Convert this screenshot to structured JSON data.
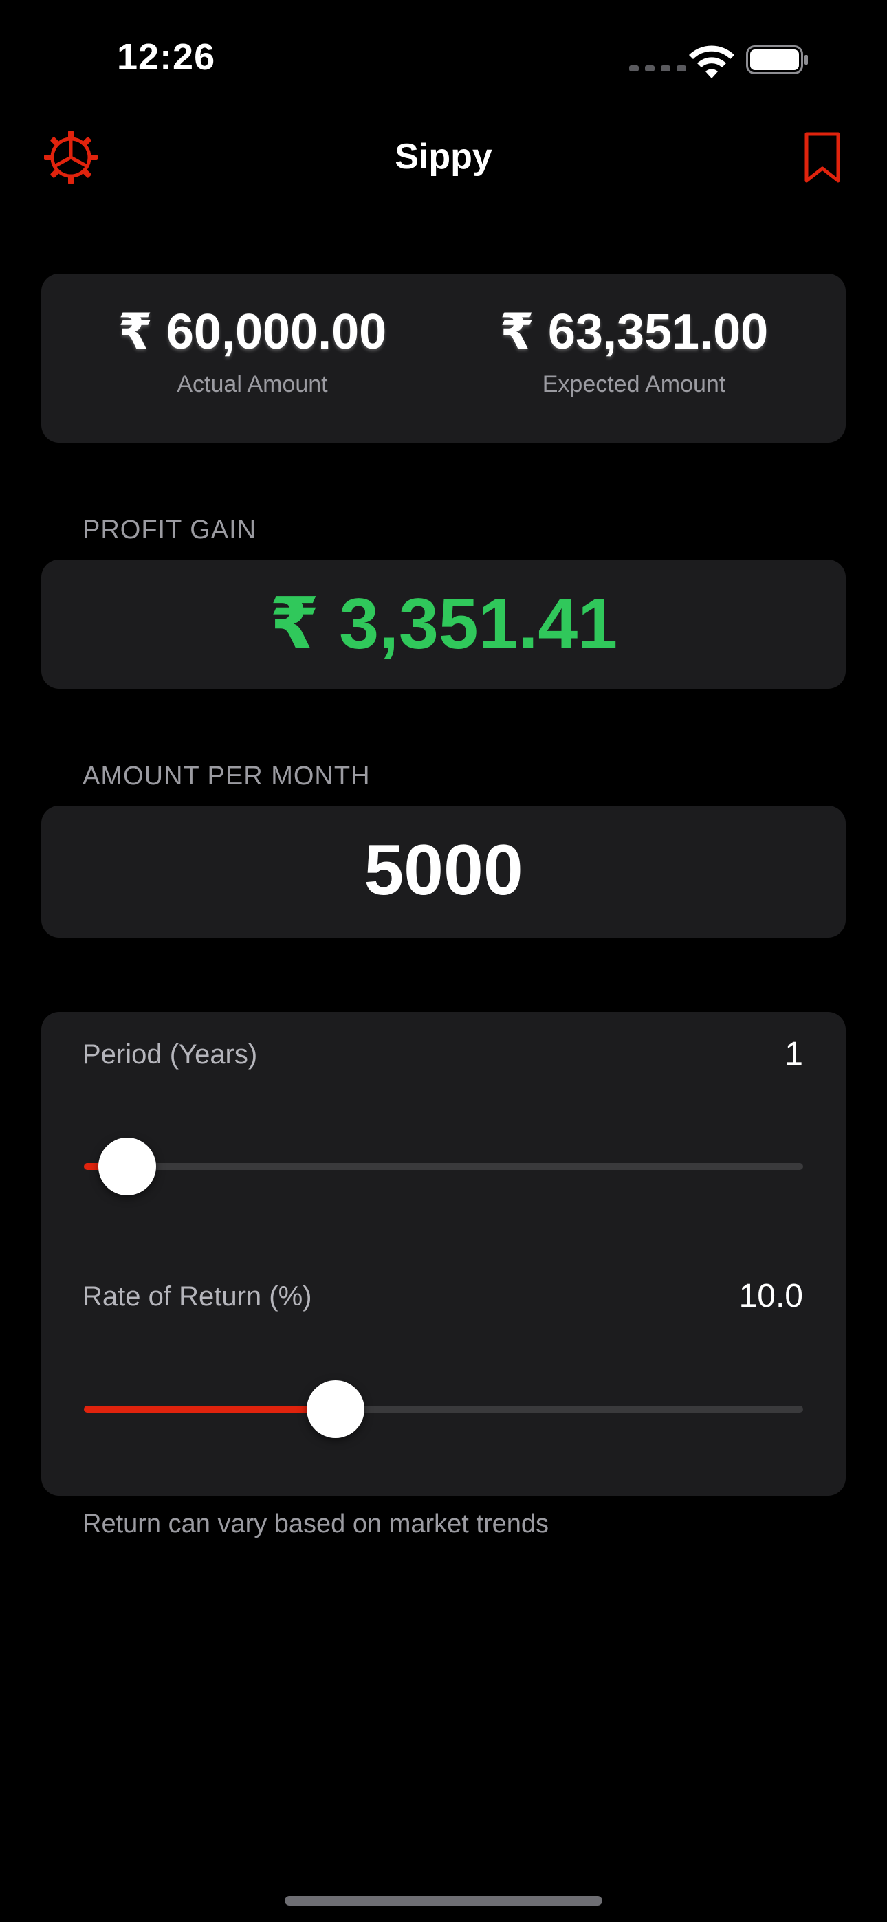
{
  "status_bar": {
    "time": "12:26",
    "icons": [
      "cellular-signal-icon",
      "wifi-icon",
      "battery-icon"
    ]
  },
  "nav": {
    "title": "Sippy",
    "left_icon": "gear-icon",
    "right_icon": "bookmark-icon",
    "accent_color": "#e0230d"
  },
  "summary": {
    "actual_amount": "₹ 60,000.00",
    "actual_label": "Actual Amount",
    "expected_amount": "₹ 63,351.00",
    "expected_label": "Expected Amount"
  },
  "profit": {
    "label": "PROFIT GAIN",
    "value": "₹ 3,351.41",
    "color": "#30c85b"
  },
  "monthly": {
    "label": "AMOUNT PER MONTH",
    "value": "5000"
  },
  "sliders": {
    "period": {
      "label": "Period (Years)",
      "value": "1",
      "fill_fraction": 0.06
    },
    "rate": {
      "label": "Rate of Return (%)",
      "value": "10.0",
      "fill_fraction": 0.35
    }
  },
  "footnote": "Return can vary based on market trends"
}
